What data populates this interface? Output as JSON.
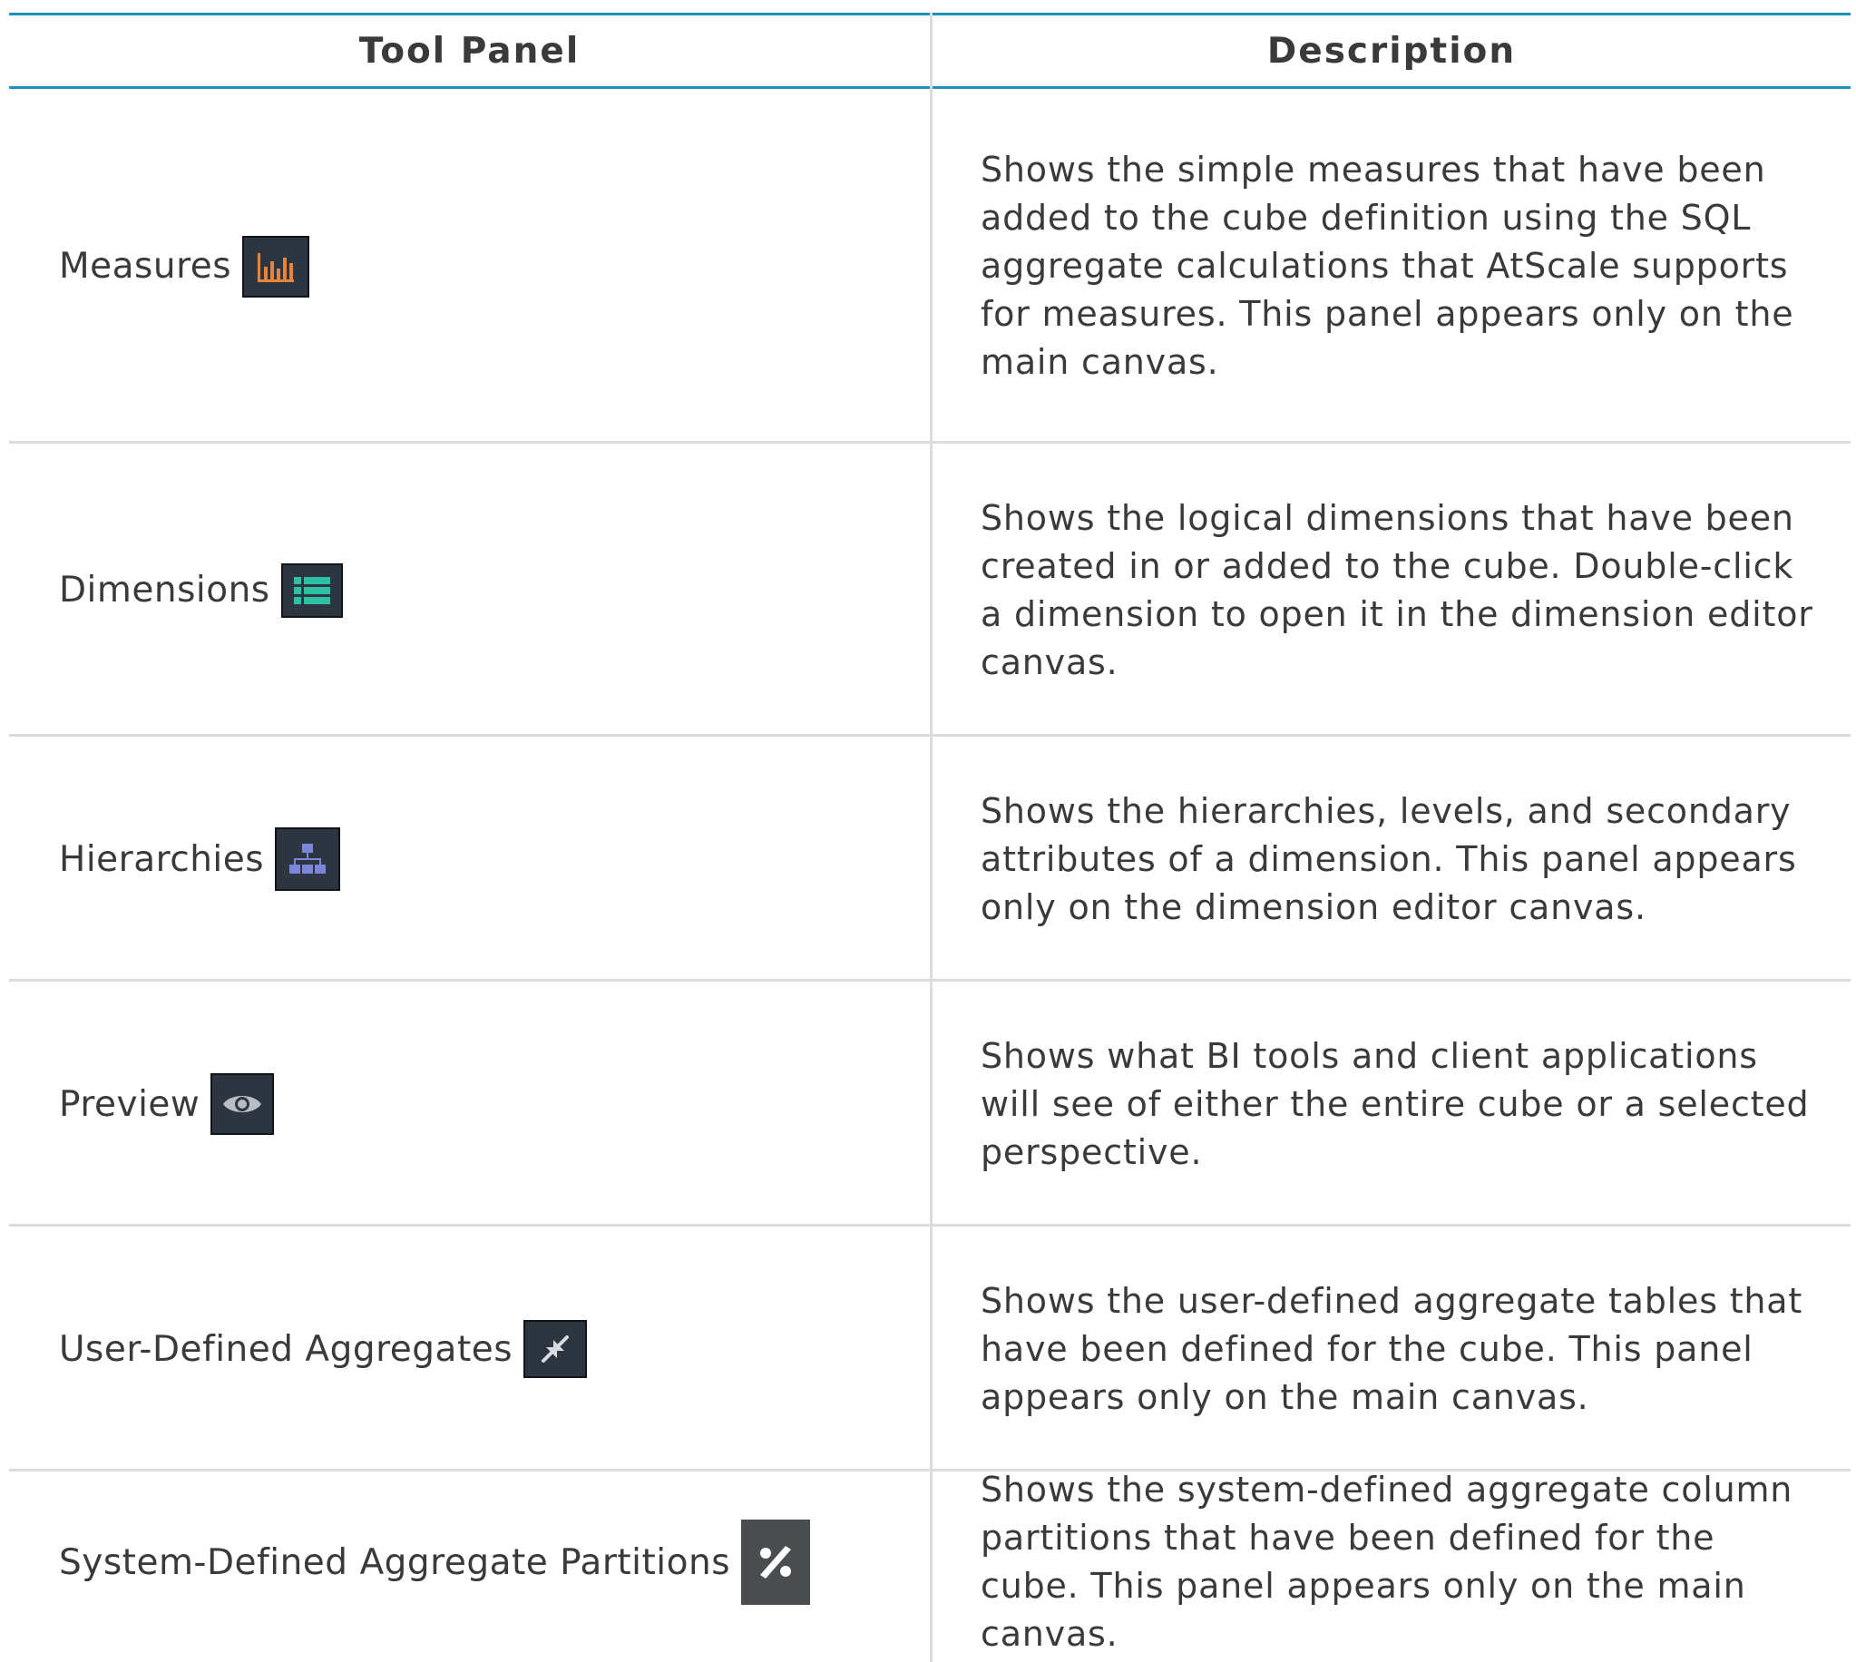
{
  "table": {
    "headers": {
      "tool_panel": "Tool Panel",
      "description": "Description"
    },
    "rows": [
      {
        "name": "Measures",
        "icon": "bar-chart-icon",
        "icon_color": "#e8843a",
        "description": "Shows the simple measures that have been added to the cube definition using the SQL aggregate calculations that AtScale supports for measures. This panel appears only on the main canvas."
      },
      {
        "name": "Dimensions",
        "icon": "list-icon",
        "icon_color": "#2fbfa6",
        "description": "Shows the logical dimensions that have been created in or added to the cube. Double-click a dimension to open it in the dimension editor canvas."
      },
      {
        "name": "Hierarchies",
        "icon": "hierarchy-icon",
        "icon_color": "#7b86d8",
        "description": "Shows the hierarchies, levels, and secondary attributes of a dimension. This panel appears only on the dimension editor canvas."
      },
      {
        "name": "Preview",
        "icon": "eye-icon",
        "icon_color": "#b9bec4",
        "description": "Shows what BI tools and client applications will see of either the entire cube or a selected perspective."
      },
      {
        "name": "User-Defined Aggregates",
        "icon": "compress-arrows-icon",
        "icon_color": "#d9dde2",
        "description": "Shows the user-defined aggregate tables that have been defined for the cube. This panel appears only on the main canvas."
      },
      {
        "name": "System-Defined Aggregate Partitions",
        "icon": "percent-icon",
        "icon_color": "#ffffff",
        "description": "Shows the system-defined aggregate column partitions that have been defined for the cube. This panel appears only on the main canvas."
      }
    ]
  },
  "colors": {
    "header_rule": "#1f8fc0",
    "row_rule": "#dcdcdc",
    "text": "#3a3a3a",
    "icon_bg": "#2d3640"
  }
}
